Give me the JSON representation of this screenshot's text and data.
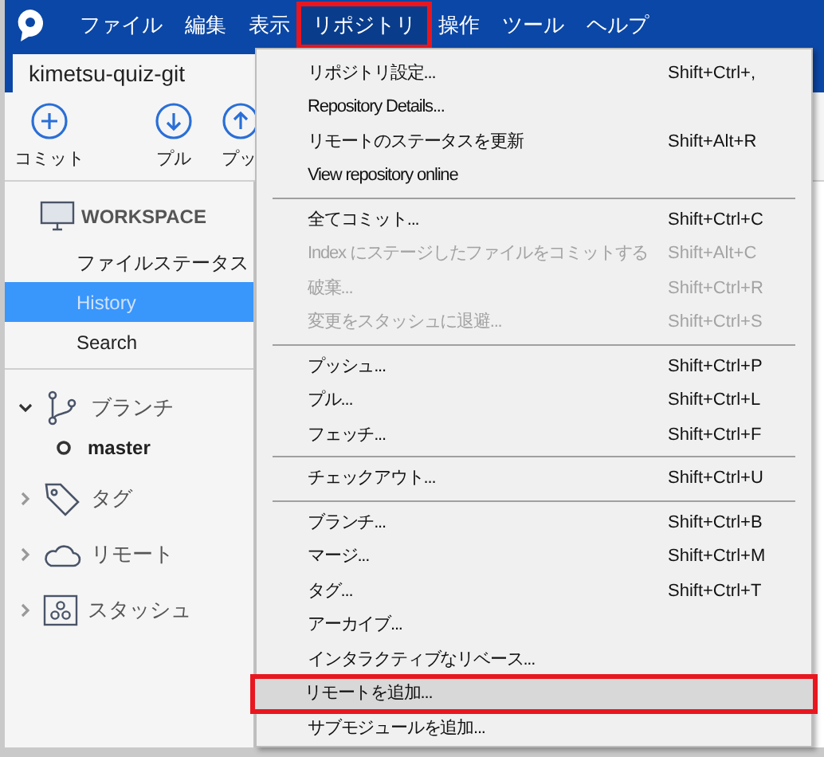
{
  "menubar": [
    {
      "label": "ファイル",
      "open": false,
      "annotated": false
    },
    {
      "label": "編集",
      "open": false,
      "annotated": false
    },
    {
      "label": "表示",
      "open": false,
      "annotated": false
    },
    {
      "label": "リポジトリ",
      "open": true,
      "annotated": true
    },
    {
      "label": "操作",
      "open": false,
      "annotated": false
    },
    {
      "label": "ツール",
      "open": false,
      "annotated": false
    },
    {
      "label": "ヘルプ",
      "open": false,
      "annotated": false
    }
  ],
  "tab": {
    "label": "kimetsu-quiz-git"
  },
  "toolbar": [
    {
      "label": "コミット",
      "kind": "plus"
    },
    {
      "label": "プル",
      "kind": "down"
    },
    {
      "label": "プッ",
      "kind": "up"
    }
  ],
  "sidebar": {
    "workspace": {
      "label": "WORKSPACE",
      "items": [
        {
          "label": "ファイルステータス",
          "selected": false
        },
        {
          "label": "History",
          "selected": true
        },
        {
          "label": "Search",
          "selected": false
        }
      ]
    },
    "sections": [
      {
        "label": "ブランチ",
        "kind": "branch",
        "expanded": true,
        "children": [
          {
            "label": "master"
          }
        ]
      },
      {
        "label": "タグ",
        "kind": "tag",
        "expanded": false
      },
      {
        "label": "リモート",
        "kind": "cloud",
        "expanded": false
      },
      {
        "label": "スタッシュ",
        "kind": "stash",
        "expanded": false
      }
    ]
  },
  "menu": [
    {
      "kind": "item",
      "label": "リポジトリ設定...",
      "shortcut": "Shift+Ctrl+,",
      "disabled": false,
      "selected": false,
      "annotated": false
    },
    {
      "kind": "item",
      "label": "Repository Details...",
      "disabled": false,
      "selected": false,
      "annotated": false
    },
    {
      "kind": "item",
      "label": "リモートのステータスを更新",
      "shortcut": "Shift+Alt+R",
      "disabled": false,
      "selected": false,
      "annotated": false
    },
    {
      "kind": "item",
      "label": "View repository online",
      "disabled": false,
      "selected": false,
      "annotated": false
    },
    {
      "kind": "separator"
    },
    {
      "kind": "item",
      "label": "全てコミット...",
      "shortcut": "Shift+Ctrl+C",
      "disabled": false,
      "selected": false,
      "annotated": false
    },
    {
      "kind": "item",
      "label": "Index にステージしたファイルをコミットする",
      "shortcut": "Shift+Alt+C",
      "disabled": true,
      "selected": false,
      "annotated": false
    },
    {
      "kind": "item",
      "label": "破棄...",
      "shortcut": "Shift+Ctrl+R",
      "disabled": true,
      "selected": false,
      "annotated": false
    },
    {
      "kind": "item",
      "label": "変更をスタッシュに退避...",
      "shortcut": "Shift+Ctrl+S",
      "disabled": true,
      "selected": false,
      "annotated": false
    },
    {
      "kind": "separator"
    },
    {
      "kind": "item",
      "label": "プッシュ...",
      "shortcut": "Shift+Ctrl+P",
      "disabled": false,
      "selected": false,
      "annotated": false
    },
    {
      "kind": "item",
      "label": "プル...",
      "shortcut": "Shift+Ctrl+L",
      "disabled": false,
      "selected": false,
      "annotated": false
    },
    {
      "kind": "item",
      "label": "フェッチ...",
      "shortcut": "Shift+Ctrl+F",
      "disabled": false,
      "selected": false,
      "annotated": false
    },
    {
      "kind": "separator"
    },
    {
      "kind": "item",
      "label": "チェックアウト...",
      "shortcut": "Shift+Ctrl+U",
      "disabled": false,
      "selected": false,
      "annotated": false
    },
    {
      "kind": "separator"
    },
    {
      "kind": "item",
      "label": "ブランチ...",
      "shortcut": "Shift+Ctrl+B",
      "disabled": false,
      "selected": false,
      "annotated": false
    },
    {
      "kind": "item",
      "label": "マージ...",
      "shortcut": "Shift+Ctrl+M",
      "disabled": false,
      "selected": false,
      "annotated": false
    },
    {
      "kind": "item",
      "label": "タグ...",
      "shortcut": "Shift+Ctrl+T",
      "disabled": false,
      "selected": false,
      "annotated": false
    },
    {
      "kind": "item",
      "label": "アーカイブ...",
      "disabled": false,
      "selected": false,
      "annotated": false
    },
    {
      "kind": "item",
      "label": "インタラクティブなリベース...",
      "disabled": false,
      "selected": false,
      "annotated": false
    },
    {
      "kind": "item",
      "label": "リモートを追加...",
      "disabled": false,
      "selected": true,
      "annotated": true
    },
    {
      "kind": "item",
      "label": "サブモジュールを追加...",
      "disabled": false,
      "selected": false,
      "annotated": false
    }
  ]
}
